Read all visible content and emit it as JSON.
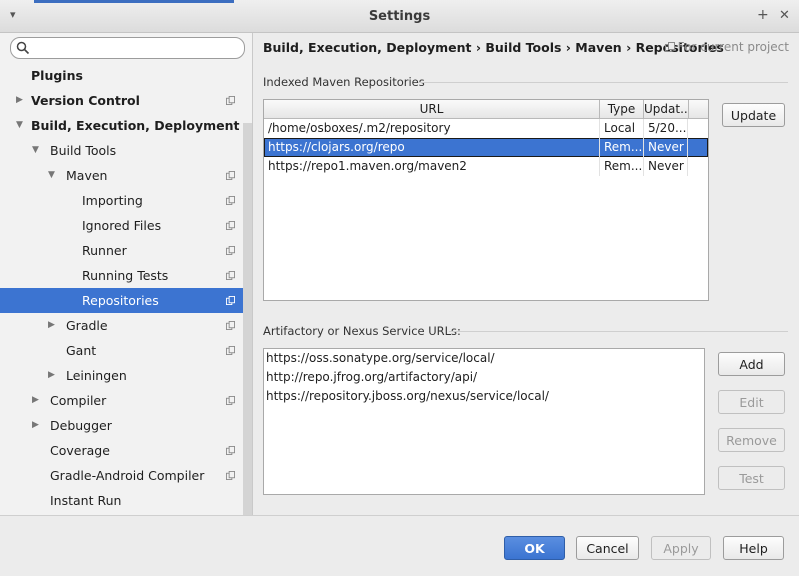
{
  "window": {
    "title": "Settings",
    "pin_glyph": "+",
    "close_glyph": "✕",
    "menu_glyph": "▾"
  },
  "search": {
    "placeholder": "",
    "icon": "search-icon"
  },
  "tree": [
    {
      "label": "Plugins",
      "bold": true,
      "arrow": "",
      "project_icon": false
    },
    {
      "label": "Version Control",
      "bold": true,
      "arrow": "▶",
      "project_icon": true
    },
    {
      "label": "Build, Execution, Deployment",
      "bold": true,
      "arrow": "▼",
      "project_icon": false
    },
    {
      "label": "Build Tools",
      "bold": false,
      "arrow": "▼",
      "project_icon": false
    },
    {
      "label": "Maven",
      "bold": false,
      "arrow": "▼",
      "project_icon": true
    },
    {
      "label": "Importing",
      "bold": false,
      "arrow": "",
      "project_icon": true
    },
    {
      "label": "Ignored Files",
      "bold": false,
      "arrow": "",
      "project_icon": true
    },
    {
      "label": "Runner",
      "bold": false,
      "arrow": "",
      "project_icon": true
    },
    {
      "label": "Running Tests",
      "bold": false,
      "arrow": "",
      "project_icon": true
    },
    {
      "label": "Repositories",
      "bold": false,
      "arrow": "",
      "project_icon": true,
      "selected": true
    },
    {
      "label": "Gradle",
      "bold": false,
      "arrow": "▶",
      "project_icon": true
    },
    {
      "label": "Gant",
      "bold": false,
      "arrow": "",
      "project_icon": true
    },
    {
      "label": "Leiningen",
      "bold": false,
      "arrow": "▶",
      "project_icon": false
    },
    {
      "label": "Compiler",
      "bold": false,
      "arrow": "▶",
      "project_icon": true
    },
    {
      "label": "Debugger",
      "bold": false,
      "arrow": "▶",
      "project_icon": false
    },
    {
      "label": "Coverage",
      "bold": false,
      "arrow": "",
      "project_icon": true
    },
    {
      "label": "Gradle-Android Compiler",
      "bold": false,
      "arrow": "",
      "project_icon": true
    },
    {
      "label": "Instant Run",
      "bold": false,
      "arrow": "",
      "project_icon": false
    }
  ],
  "breadcrumb": {
    "items": [
      "Build, Execution, Deployment",
      "Build Tools",
      "Maven",
      "Repositories"
    ],
    "separator": "›",
    "scope_label": "For current project"
  },
  "indexed": {
    "heading": "Indexed Maven Repositories",
    "columns": [
      "URL",
      "Type",
      "Updat..."
    ],
    "rows": [
      {
        "url": "/home/osboxes/.m2/repository",
        "type": "Local",
        "updated": "5/20..."
      },
      {
        "url": "https://clojars.org/repo",
        "type": "Rem...",
        "updated": "Never",
        "selected": true
      },
      {
        "url": "https://repo1.maven.org/maven2",
        "type": "Rem...",
        "updated": "Never"
      }
    ],
    "update_button": "Update"
  },
  "artifactory": {
    "heading": "Artifactory or Nexus Service URLs:",
    "urls": [
      "https://oss.sonatype.org/service/local/",
      "http://repo.jfrog.org/artifactory/api/",
      "https://repository.jboss.org/nexus/service/local/"
    ],
    "buttons": {
      "add": "Add",
      "edit": "Edit",
      "remove": "Remove",
      "test": "Test"
    }
  },
  "footer": {
    "ok": "OK",
    "cancel": "Cancel",
    "apply": "Apply",
    "help": "Help"
  },
  "colors": {
    "selection": "#3c74d1",
    "primary_button": "#3b74d1"
  }
}
